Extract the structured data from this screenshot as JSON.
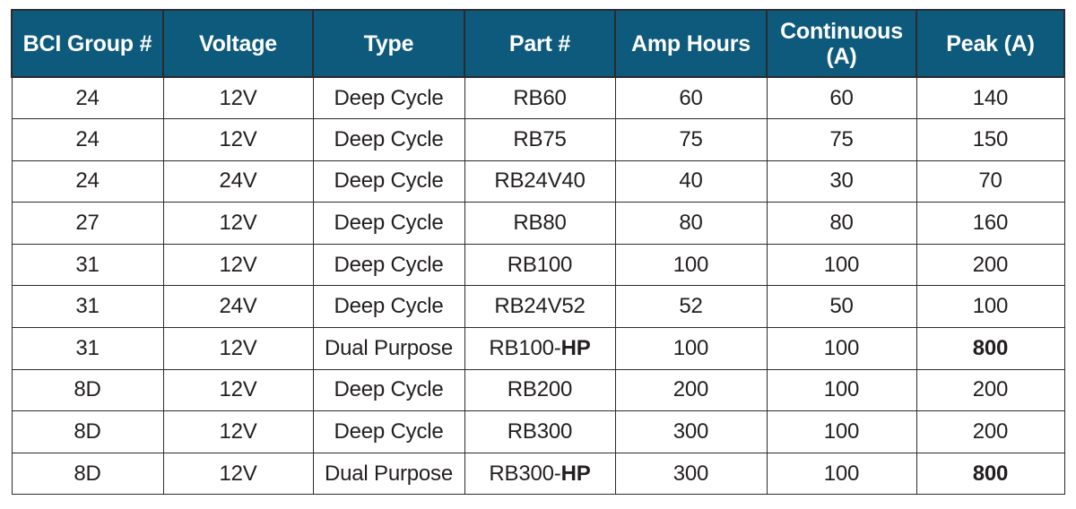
{
  "table": {
    "name": "battery-specifications-table",
    "accent_color": "#0d5a7d",
    "header_text_color": "#ffffff",
    "body_text_color": "#231f20",
    "border_color": "#2b2b2b",
    "columns": [
      "BCI Group #",
      "Voltage",
      "Type",
      "Part #",
      "Amp Hours",
      "Continuous (A)",
      "Peak (A)"
    ],
    "rows": [
      {
        "bci_group": "24",
        "voltage": "12V",
        "type": "Deep Cycle",
        "part_base": "RB60",
        "part_suffix": "",
        "amp_hours": "60",
        "continuous": "60",
        "peak": "140",
        "peak_bold": false
      },
      {
        "bci_group": "24",
        "voltage": "12V",
        "type": "Deep Cycle",
        "part_base": "RB75",
        "part_suffix": "",
        "amp_hours": "75",
        "continuous": "75",
        "peak": "150",
        "peak_bold": false
      },
      {
        "bci_group": "24",
        "voltage": "24V",
        "type": "Deep Cycle",
        "part_base": "RB24V40",
        "part_suffix": "",
        "amp_hours": "40",
        "continuous": "30",
        "peak": "70",
        "peak_bold": false
      },
      {
        "bci_group": "27",
        "voltage": "12V",
        "type": "Deep Cycle",
        "part_base": "RB80",
        "part_suffix": "",
        "amp_hours": "80",
        "continuous": "80",
        "peak": "160",
        "peak_bold": false
      },
      {
        "bci_group": "31",
        "voltage": "12V",
        "type": "Deep Cycle",
        "part_base": "RB100",
        "part_suffix": "",
        "amp_hours": "100",
        "continuous": "100",
        "peak": "200",
        "peak_bold": false
      },
      {
        "bci_group": "31",
        "voltage": "24V",
        "type": "Deep Cycle",
        "part_base": "RB24V52",
        "part_suffix": "",
        "amp_hours": "52",
        "continuous": "50",
        "peak": "100",
        "peak_bold": false
      },
      {
        "bci_group": "31",
        "voltage": "12V",
        "type": "Dual Purpose",
        "part_base": "RB100-",
        "part_suffix": "HP",
        "amp_hours": "100",
        "continuous": "100",
        "peak": "800",
        "peak_bold": true
      },
      {
        "bci_group": "8D",
        "voltage": "12V",
        "type": "Deep Cycle",
        "part_base": "RB200",
        "part_suffix": "",
        "amp_hours": "200",
        "continuous": "100",
        "peak": "200",
        "peak_bold": false
      },
      {
        "bci_group": "8D",
        "voltage": "12V",
        "type": "Deep Cycle",
        "part_base": "RB300",
        "part_suffix": "",
        "amp_hours": "300",
        "continuous": "100",
        "peak": "200",
        "peak_bold": false
      },
      {
        "bci_group": "8D",
        "voltage": "12V",
        "type": "Dual Purpose",
        "part_base": "RB300-",
        "part_suffix": "HP",
        "amp_hours": "300",
        "continuous": "100",
        "peak": "800",
        "peak_bold": true
      }
    ]
  }
}
